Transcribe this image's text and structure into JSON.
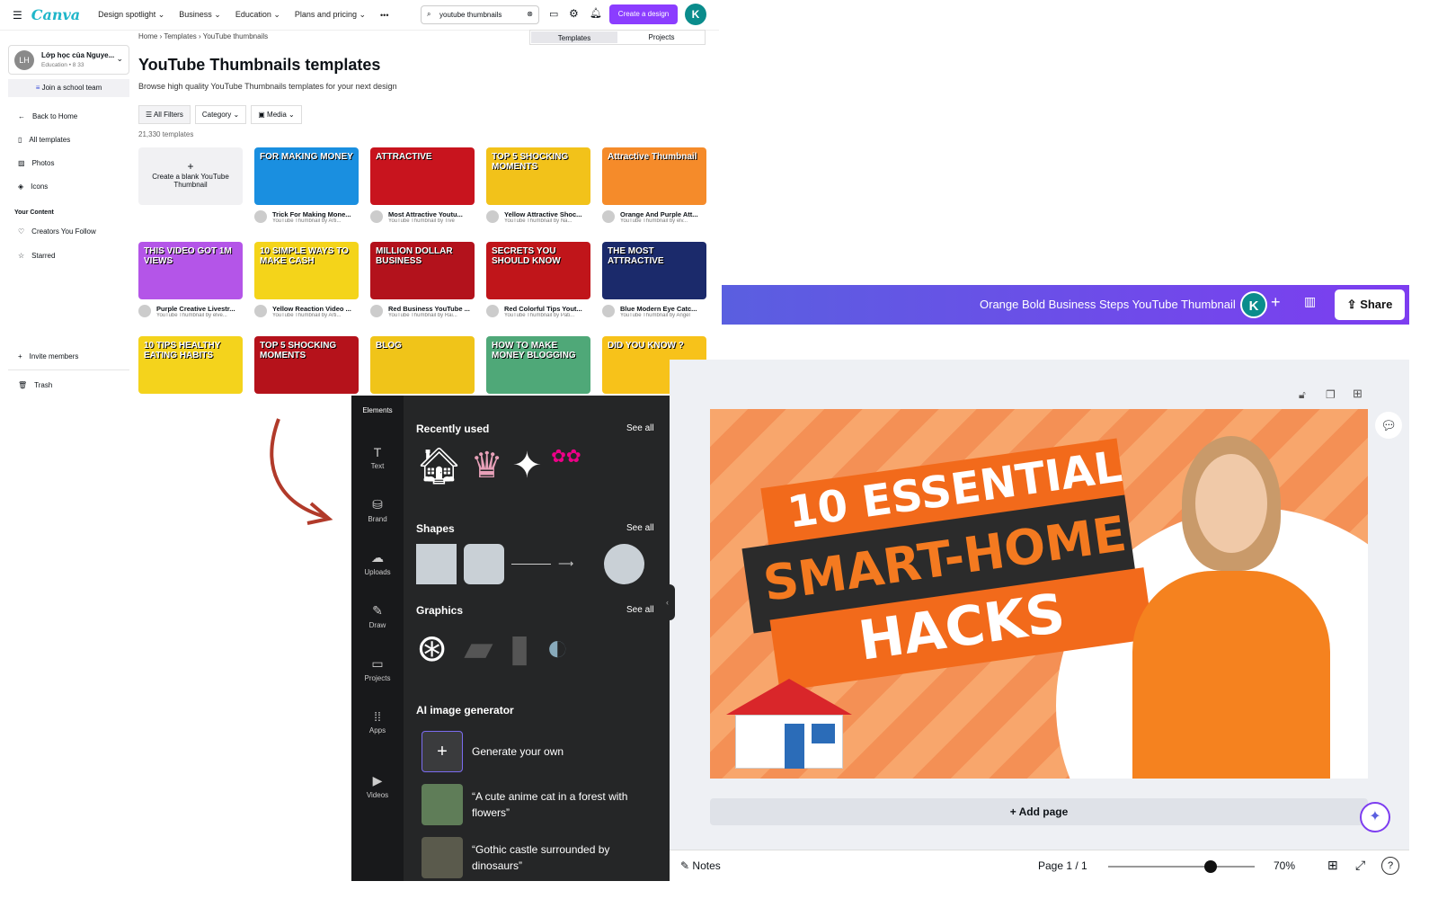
{
  "canva": {
    "logo": "Canva",
    "nav": [
      "Design spotlight",
      "Business",
      "Education",
      "Plans and pricing"
    ],
    "more": "•••",
    "search_value": "youtube thumbnails",
    "create_button": "Create a design",
    "avatar": "K",
    "breadcrumb": [
      "Home",
      "Templates",
      "YouTube thumbnails"
    ],
    "toggle": [
      "Templates",
      "Projects"
    ],
    "title": "YouTube Thumbnails templates",
    "subtitle": "Browse high quality YouTube Thumbnails templates for your next design",
    "filters": [
      "All Filters",
      "Category",
      "Media"
    ],
    "count": "21,330 templates",
    "create_blank": "Create a blank YouTube Thumbnail",
    "team": {
      "initials": "LH",
      "name": "Lớp học của Nguye...",
      "meta": "Education • 8 33",
      "join": "Join a school team"
    },
    "sidebar": [
      "Back to Home",
      "All templates",
      "Photos",
      "Icons"
    ],
    "your_content": "Your Content",
    "sidebar2": [
      "Creators You Follow",
      "Starred"
    ],
    "sidebar3": [
      "Invite members",
      "Trash"
    ],
    "help": "?",
    "templates": [
      {
        "text": "FOR MAKING MONEY",
        "color": "#1a8fe0",
        "title": "Trick For Making Mone...",
        "by": "YouTube Thumbnail by Arti..."
      },
      {
        "text": "ATTRACTIVE",
        "color": "#c8141e",
        "title": "Most Attractive Youtu...",
        "by": "YouTube Thumbnail by Tive"
      },
      {
        "text": "TOP 5 SHOCKING MOMENTS",
        "color": "#f2c21a",
        "title": "Yellow Attractive Shoc...",
        "by": "YouTube Thumbnail by Na..."
      },
      {
        "text": "Attractive Thumbnail",
        "color": "#f58b2a",
        "title": "Orange And Purple Att...",
        "by": "YouTube Thumbnail by elv..."
      },
      {
        "text": "THIS VIDEO GOT 1M VIEWS",
        "color": "#b455e8",
        "title": "Purple Creative Livestr...",
        "by": "YouTube Thumbnail by elve..."
      },
      {
        "text": "10 SIMPLE WAYS TO MAKE CASH",
        "color": "#f4d41a",
        "title": "Yellow Reaction Video ...",
        "by": "YouTube Thumbnail by Arti..."
      },
      {
        "text": "MILLION DOLLAR BUSINESS",
        "color": "#b3121c",
        "title": "Red Business YouTube ...",
        "by": "YouTube Thumbnail by Rai..."
      },
      {
        "text": "SECRETS YOU SHOULD KNOW",
        "color": "#c0151a",
        "title": "Red Colorful Tips Yout...",
        "by": "YouTube Thumbnail by Pati..."
      },
      {
        "text": "THE MOST ATTRACTIVE",
        "color": "#1b2a6b",
        "title": "Blue Modern Eye Catc...",
        "by": "YouTube Thumbnail by Angel"
      },
      {
        "text": "10 TIPS HEALTHY EATING HABITS",
        "color": "#f4d31c",
        "title": "",
        "by": ""
      },
      {
        "text": "TOP 5 SHOCKING MOMENTS",
        "color": "#b5121b",
        "title": "",
        "by": ""
      },
      {
        "text": "BLOG",
        "color": "#f0c419",
        "title": "",
        "by": ""
      },
      {
        "text": "HOW TO MAKE MONEY BLOGGING",
        "color": "#4fa878",
        "title": "",
        "by": ""
      },
      {
        "text": "DID YOU KNOW ?",
        "color": "#f7c21a",
        "title": "",
        "by": ""
      }
    ]
  },
  "editor": {
    "design_title": "Orange Bold Business Steps YouTube Thumbnail",
    "avatar": "K",
    "share": "Share",
    "rail": [
      "Elements",
      "Text",
      "Brand",
      "Uploads",
      "Draw",
      "Projects",
      "Apps",
      "Videos"
    ],
    "sections": {
      "recent": "Recently used",
      "shapes": "Shapes",
      "graphics": "Graphics",
      "ai": "AI image generator",
      "see_all": "See all"
    },
    "ai_items": [
      "Generate your own",
      "“A cute anime cat in a forest with flowers”",
      "“Gothic castle surrounded by dinosaurs”"
    ],
    "design_lines": [
      "10 ESSENTIAL",
      "SMART-HOME",
      "HACKS"
    ],
    "add_page": "+ Add page",
    "notes": "Notes",
    "page": "Page 1 / 1",
    "zoom": "70%",
    "zoom_value": 70
  },
  "colors": {
    "brand": "#8b3dff",
    "design_orange": "#f47a20",
    "panel": "#252627"
  }
}
